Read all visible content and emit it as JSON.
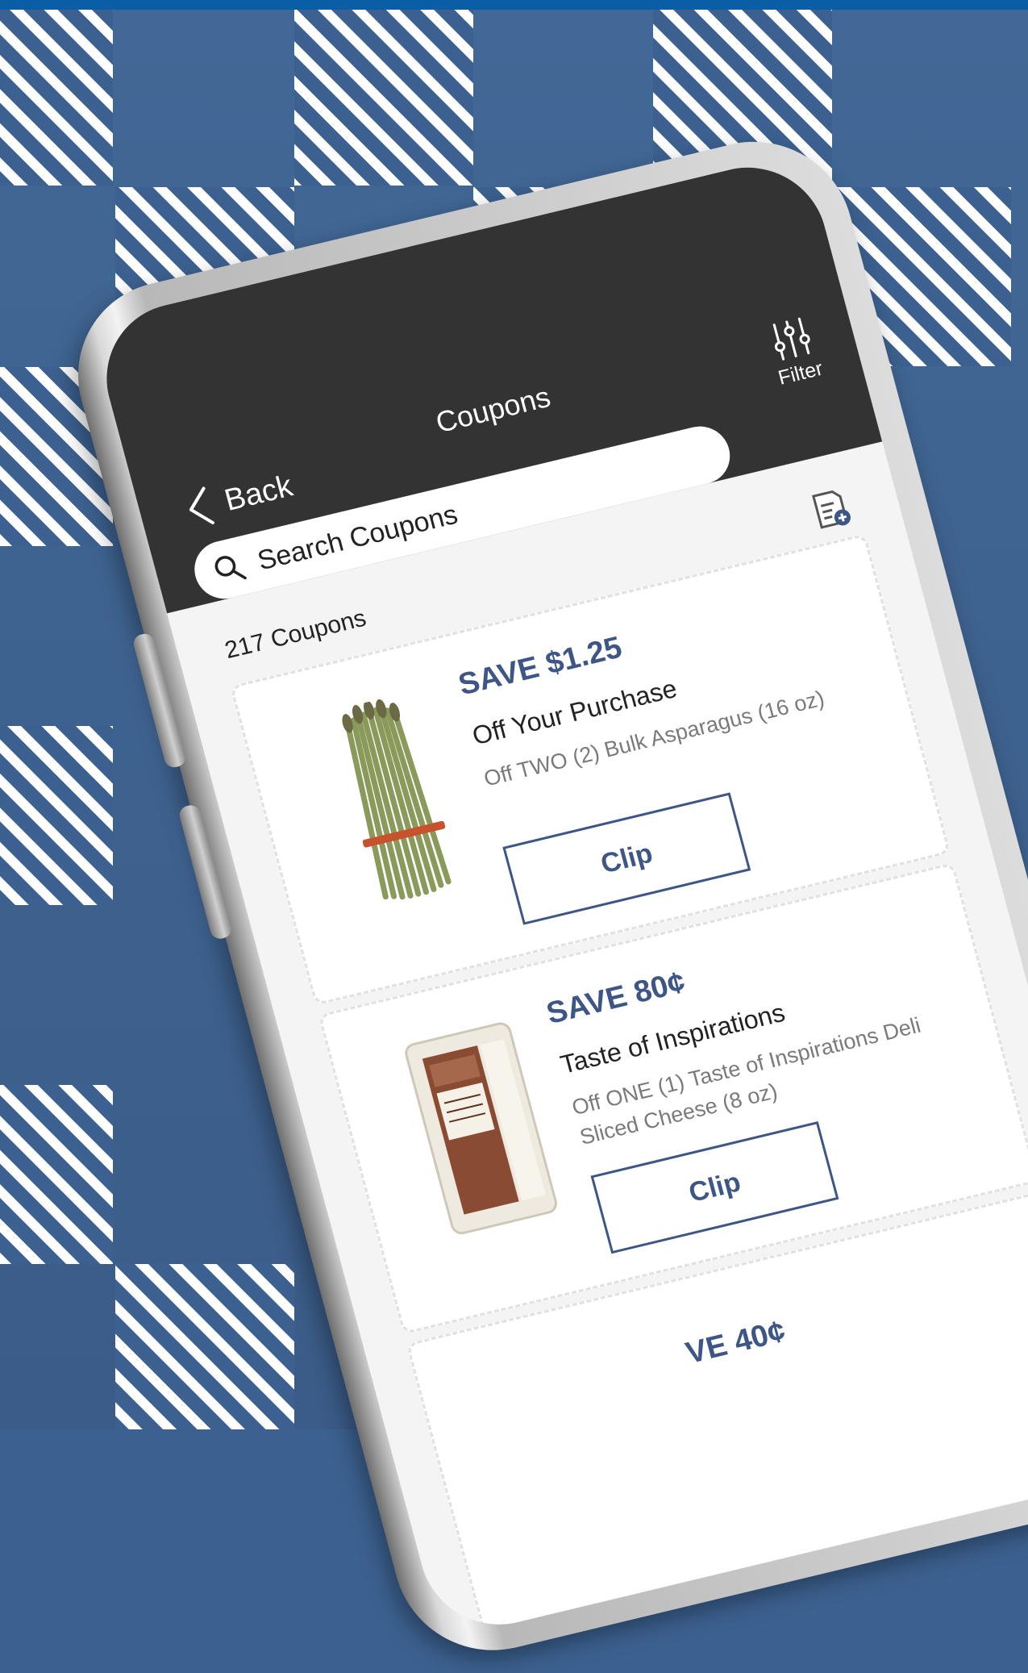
{
  "header": {
    "back_label": "Back",
    "title": "Coupons",
    "filter_label": "Filter"
  },
  "search": {
    "placeholder": "Search Coupons"
  },
  "coupon_count": "217 Coupons",
  "coupons": [
    {
      "save": "SAVE $1.25",
      "brand": "Off Your Purchase",
      "description": "Off TWO (2) Bulk Asparagus (16 oz)",
      "button": "Clip",
      "image": "asparagus"
    },
    {
      "save": "SAVE 80¢",
      "brand": "Taste of Inspirations",
      "description": "Off ONE (1) Taste of Inspirations Deli Sliced Cheese (8 oz)",
      "button": "Clip",
      "image": "swiss-cheese-package"
    },
    {
      "save": "VE 40¢"
    }
  ],
  "colors": {
    "background": "#3c6190",
    "accent": "#3e5686",
    "header": "#333333",
    "top_bar": "#0a5ea6"
  }
}
